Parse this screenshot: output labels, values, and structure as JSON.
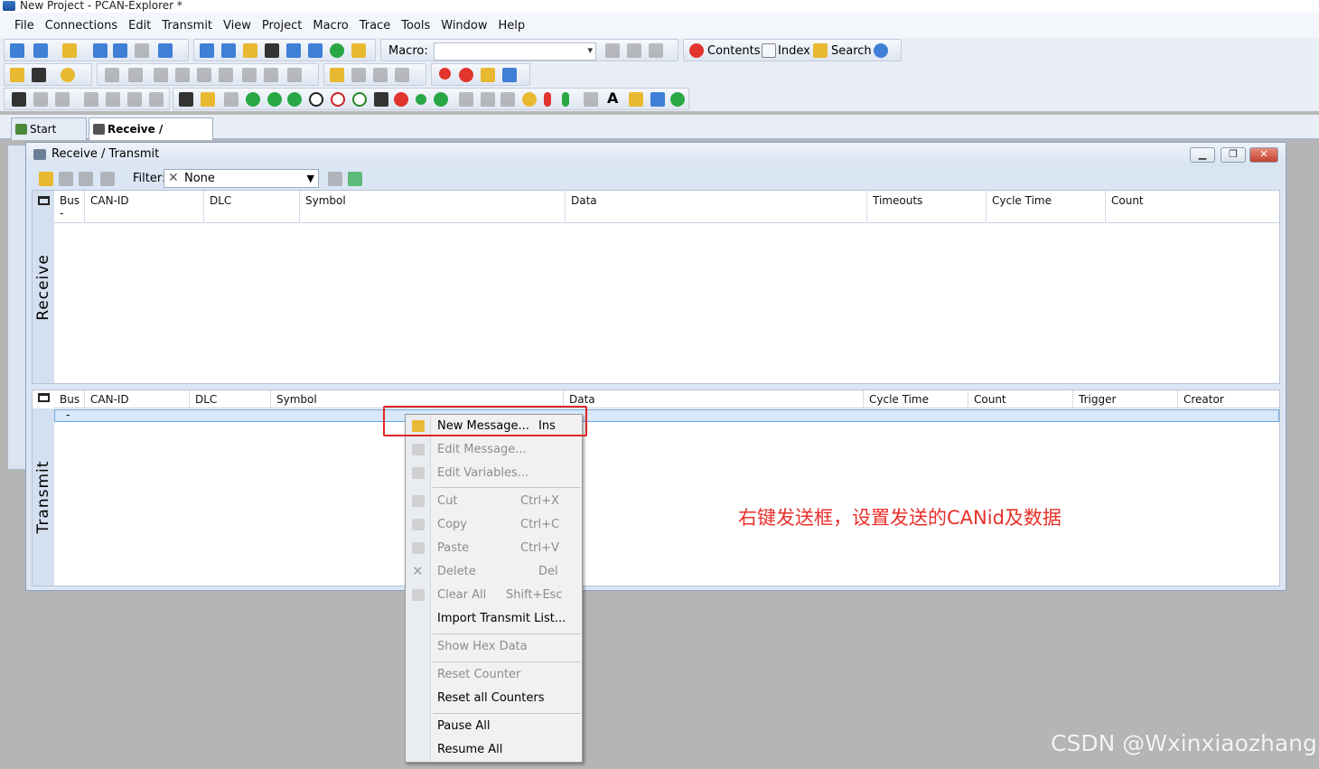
{
  "window": {
    "title": "New Project - PCAN-Explorer *"
  },
  "menubar": [
    "File",
    "Connections",
    "Edit",
    "Transmit",
    "View",
    "Project",
    "Macro",
    "Trace",
    "Tools",
    "Window",
    "Help"
  ],
  "toolbar": {
    "macro_label": "Macro:",
    "contents_label": "Contents",
    "index_label": "Index",
    "search_label": "Search"
  },
  "tabs": [
    {
      "label": "Start Page",
      "active": false
    },
    {
      "label": "Receive / Transmit",
      "active": true
    }
  ],
  "mdi_window": {
    "title": "Receive / Transmit",
    "filter_label": "Filter:",
    "filter_value": "None"
  },
  "receive": {
    "side_label": "Receive",
    "columns": [
      "Bus",
      "CAN-ID",
      "DLC",
      "Symbol",
      "Data",
      "Timeouts",
      "Cycle Time",
      "Count"
    ],
    "row_placeholder": "-"
  },
  "transmit": {
    "side_label": "Transmit",
    "columns": [
      "Bus",
      "CAN-ID",
      "DLC",
      "Symbol",
      "Data",
      "Cycle Time",
      "Count",
      "Trigger",
      "Creator"
    ],
    "row_placeholder": "-"
  },
  "context_menu": {
    "items": [
      {
        "label": "New Message...",
        "shortcut": "Ins",
        "enabled": true
      },
      {
        "label": "Edit Message...",
        "shortcut": "",
        "enabled": false
      },
      {
        "label": "Edit Variables...",
        "shortcut": "",
        "enabled": false
      },
      {
        "label": "Cut",
        "shortcut": "Ctrl+X",
        "enabled": false
      },
      {
        "label": "Copy",
        "shortcut": "Ctrl+C",
        "enabled": false
      },
      {
        "label": "Paste",
        "shortcut": "Ctrl+V",
        "enabled": false
      },
      {
        "label": "Delete",
        "shortcut": "Del",
        "enabled": false
      },
      {
        "label": "Clear All",
        "shortcut": "Shift+Esc",
        "enabled": false
      },
      {
        "label": "Import Transmit List...",
        "shortcut": "",
        "enabled": true
      },
      {
        "label": "Show Hex Data",
        "shortcut": "",
        "enabled": false
      },
      {
        "label": "Reset Counter",
        "shortcut": "",
        "enabled": false
      },
      {
        "label": "Reset all Counters",
        "shortcut": "",
        "enabled": true
      },
      {
        "label": "Pause All",
        "shortcut": "",
        "enabled": true
      },
      {
        "label": "Resume All",
        "shortcut": "",
        "enabled": true
      }
    ]
  },
  "annotation": "右键发送框，设置发送的CANid及数据",
  "watermark": "CSDN @Wxinxiaozhang",
  "colors": {
    "annotation": "#e8302a",
    "highlight_border": "#e02626",
    "selection": "#d7e8fb"
  }
}
